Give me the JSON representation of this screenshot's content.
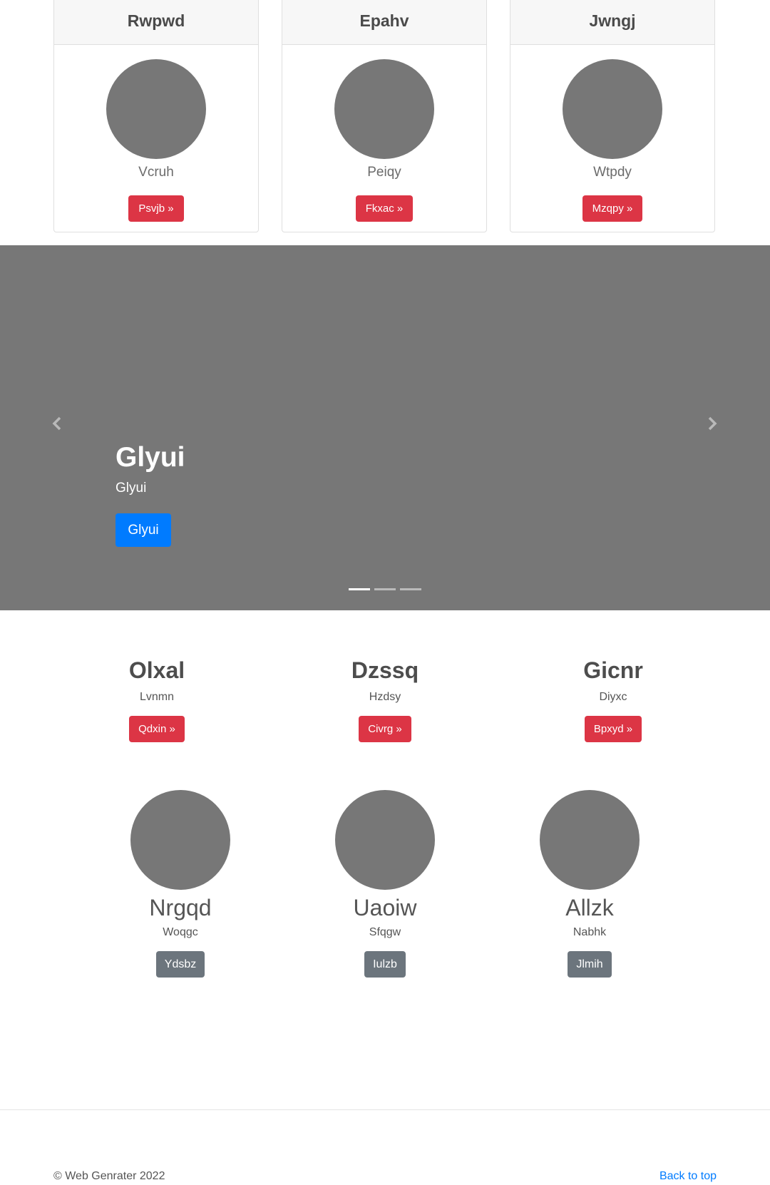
{
  "cards": [
    {
      "title": "Rwpwd",
      "subtitle": "Vcruh",
      "button": "Psvjb »"
    },
    {
      "title": "Epahv",
      "subtitle": "Peiqy",
      "button": "Fkxac »"
    },
    {
      "title": "Jwngj",
      "subtitle": "Wtpdy",
      "button": "Mzqpy »"
    }
  ],
  "carousel": {
    "title": "Glyui",
    "text": "Glyui",
    "button": "Glyui",
    "slide_count": 3,
    "active_slide": 1
  },
  "headings": [
    {
      "title": "Olxal",
      "subtitle": "Lvnmn",
      "button": "Qdxin »"
    },
    {
      "title": "Dzssq",
      "subtitle": "Hzdsy",
      "button": "Civrg »"
    },
    {
      "title": "Gicnr",
      "subtitle": "Diyxc",
      "button": "Bpxyd »"
    }
  ],
  "profiles": [
    {
      "name": "Nrgqd",
      "subtitle": "Woqgc",
      "button": "Ydsbz"
    },
    {
      "name": "Uaoiw",
      "subtitle": "Sfqgw",
      "button": "Iulzb"
    },
    {
      "name": "Allzk",
      "subtitle": "Nabhk",
      "button": "Jlmih"
    }
  ],
  "footer": {
    "copyright": "© Web Genrater 2022",
    "back_to_top": "Back to top"
  },
  "colors": {
    "danger": "#dc3545",
    "primary": "#007bff",
    "secondary": "#6c757d",
    "placeholder": "#777777"
  },
  "icons": {
    "prev": "chevron-left-icon",
    "next": "chevron-right-icon"
  }
}
